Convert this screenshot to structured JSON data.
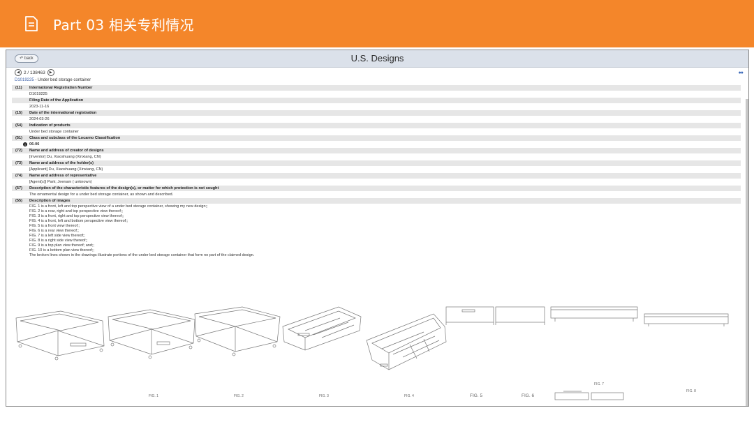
{
  "banner": {
    "title": "Part 03  相关专利情况",
    "bg_color": "#f4862a",
    "icon": "document-icon"
  },
  "header": {
    "back_label": "back",
    "title": "U.S. Designs",
    "bg_color": "#dbe1ea"
  },
  "pager": {
    "text": "2 / 138463",
    "prev_icon": "chevron-left-icon",
    "next_icon": "chevron-right-icon",
    "more_icon": "ellipsis-icon"
  },
  "document": {
    "id": "D1019225",
    "title_suffix": " - Under bed storage container",
    "link_color": "#3a5fa8"
  },
  "fields": [
    {
      "code": "(11)",
      "label": "International Registration Number",
      "value": "D1019225"
    },
    {
      "code": "",
      "label": "Filing Date of the Application",
      "value": "2023-11-16"
    },
    {
      "code": "(15)",
      "label": "Date of the international registration",
      "value": "2024-03-26"
    },
    {
      "code": "(54)",
      "label": "Indication of products",
      "value": "Under bed storage container"
    },
    {
      "code": "(51)",
      "label": "Class and subclass of the Locarno Classification",
      "value": "06-06"
    },
    {
      "code": "(72)",
      "label": "Name and address of creator of designs",
      "value": "[Inventor] Du, Xiaoshuang (Xinxiang, CN)"
    },
    {
      "code": "(73)",
      "label": "Name and address of the holder(s)",
      "value": "[Applicant]  Du, Xiaoshuang (Xinxiang, CN)"
    },
    {
      "code": "(74)",
      "label": "Name and address of representative",
      "value": "[Agent(s)] Park; Jeenam ( unknown)"
    },
    {
      "code": "(57)",
      "label": "Description of the characteristic features of the design(s), or matter for which protection is not sought",
      "value": "The ornamental design for a under bed storage container, as shown and described."
    },
    {
      "code": "(55)",
      "label": "Description of images"
    }
  ],
  "image_descriptions": [
    "FIG. 1 is a front, left and top perspective view of a under bed storage container, showing my new design;;",
    "FIG. 2 is a rear, right and top perspective view thereof;;",
    "FIG. 3 is a front, right and top perspective view thereof;;",
    "FIG. 4 is a front, left and bottom perspective view thereof;;",
    "FIG. 5 is a front view thereof;;",
    "FIG. 6 is a rear view thereof;;",
    "FIG. 7 is a left side view thereof;;",
    "FIG. 8 is a right side view thereof;;",
    "FIG. 9 is a top plan view thereof; and;;",
    "FIG. 10 is a bottom plan view thereof;;",
    "The broken lines shown in the drawings illustrate portions of the under bed storage container that form no part of the claimed design."
  ],
  "figure_labels": [
    "FIG. 1",
    "FIG. 2",
    "FIG. 3",
    "FIG. 4",
    "FIG. 5",
    "FIG. 6",
    "FIG. 7",
    "FIG. 8"
  ]
}
